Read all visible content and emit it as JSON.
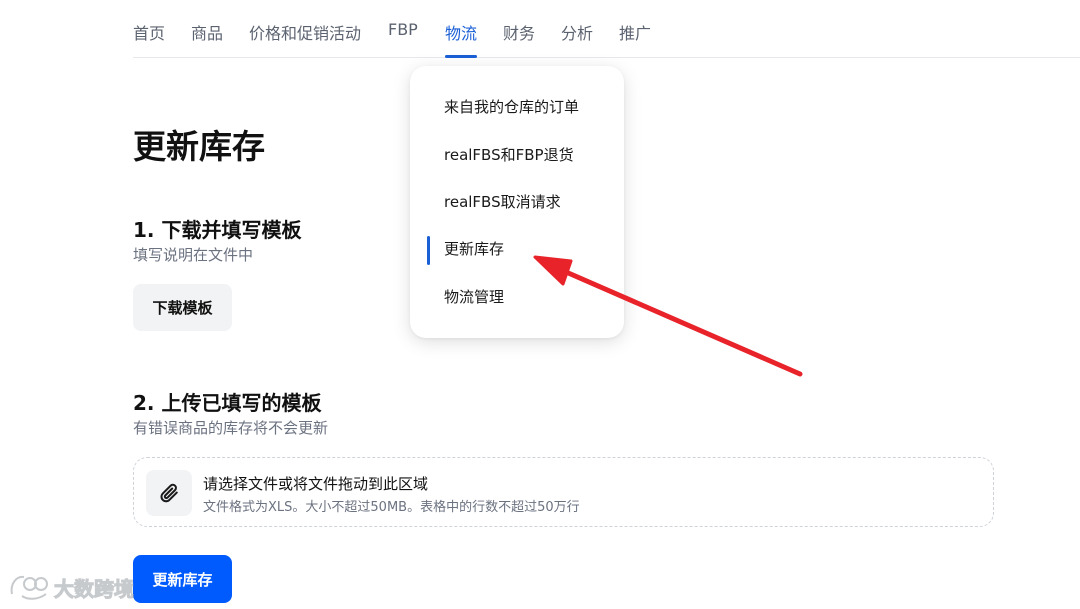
{
  "nav": {
    "tabs": [
      {
        "label": "首页"
      },
      {
        "label": "商品"
      },
      {
        "label": "价格和促销活动"
      },
      {
        "label": "FBP"
      },
      {
        "label": "物流"
      },
      {
        "label": "财务"
      },
      {
        "label": "分析"
      },
      {
        "label": "推广"
      }
    ],
    "active_tab": "物流"
  },
  "page": {
    "title": "更新库存",
    "step1": {
      "title": "1. 下载并填写模板",
      "desc": "填写说明在文件中",
      "button": "下载模板"
    },
    "step2": {
      "title": "2. 上传已填写的模板",
      "desc": "有错误商品的库存将不会更新"
    },
    "dropzone": {
      "title": "请选择文件或将文件拖动到此区域",
      "hint": "文件格式为XLS。大小不超过50MB。表格中的行数不超过50万行"
    },
    "submit_button": "更新库存"
  },
  "dropdown": {
    "items": [
      {
        "label": "来自我的仓库的订单"
      },
      {
        "label": "realFBS和FBP退货"
      },
      {
        "label": "realFBS取消请求"
      },
      {
        "label": "更新库存"
      },
      {
        "label": "物流管理"
      }
    ],
    "active_item": "更新库存"
  },
  "watermark": {
    "text": "大数跨境"
  },
  "colors": {
    "accent": "#1a5fd6",
    "primary_button": "#005bff",
    "annotation_arrow": "#e8232a"
  },
  "icons": {
    "dropzone": "paperclip-icon",
    "watermark": "logo-icon"
  }
}
